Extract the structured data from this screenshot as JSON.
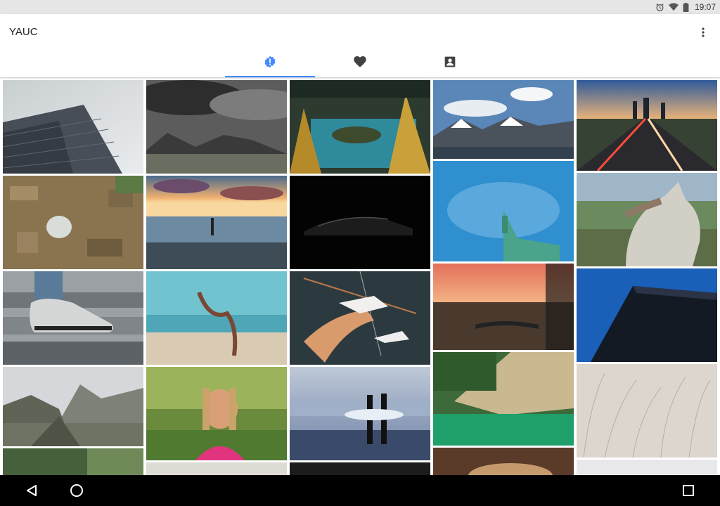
{
  "status_bar": {
    "time": "19:07",
    "icons": [
      "alarm-icon",
      "wifi-icon",
      "battery-icon"
    ]
  },
  "app_bar": {
    "title": "YAUC",
    "overflow_icon": "more-vert-icon"
  },
  "tabs": [
    {
      "icon": "alert-badge-icon",
      "selected": true
    },
    {
      "icon": "heart-icon",
      "selected": false
    },
    {
      "icon": "account-box-icon",
      "selected": false
    }
  ],
  "colors": {
    "accent": "#448aff",
    "status_bar": "#e6e6e6",
    "nav_bar": "#000000"
  },
  "photos": [
    "building-facade-photo",
    "aerial-village-photo",
    "sneakers-stairs-photo",
    "machu-picchu-photo",
    "forest-photo",
    "stormy-mountain-photo",
    "beach-sunset-yoga-photo",
    "beach-yoga-photo",
    "girl-confetti-photo",
    "partial-photo",
    "lake-pine-trees-photo",
    "dark-car-photo",
    "paper-birds-hand-photo",
    "surfers-beach-photo",
    "snowy-mountains-photo",
    "statue-of-liberty-photo",
    "sunset-field-photo",
    "aerial-lake-photo",
    "coffee-cup-photo",
    "city-highway-night-photo",
    "husky-dog-photo",
    "dark-building-sky-photo",
    "dry-grass-photo"
  ],
  "nav_bar": {
    "buttons": [
      "back-icon",
      "home-icon",
      "recents-icon"
    ]
  }
}
